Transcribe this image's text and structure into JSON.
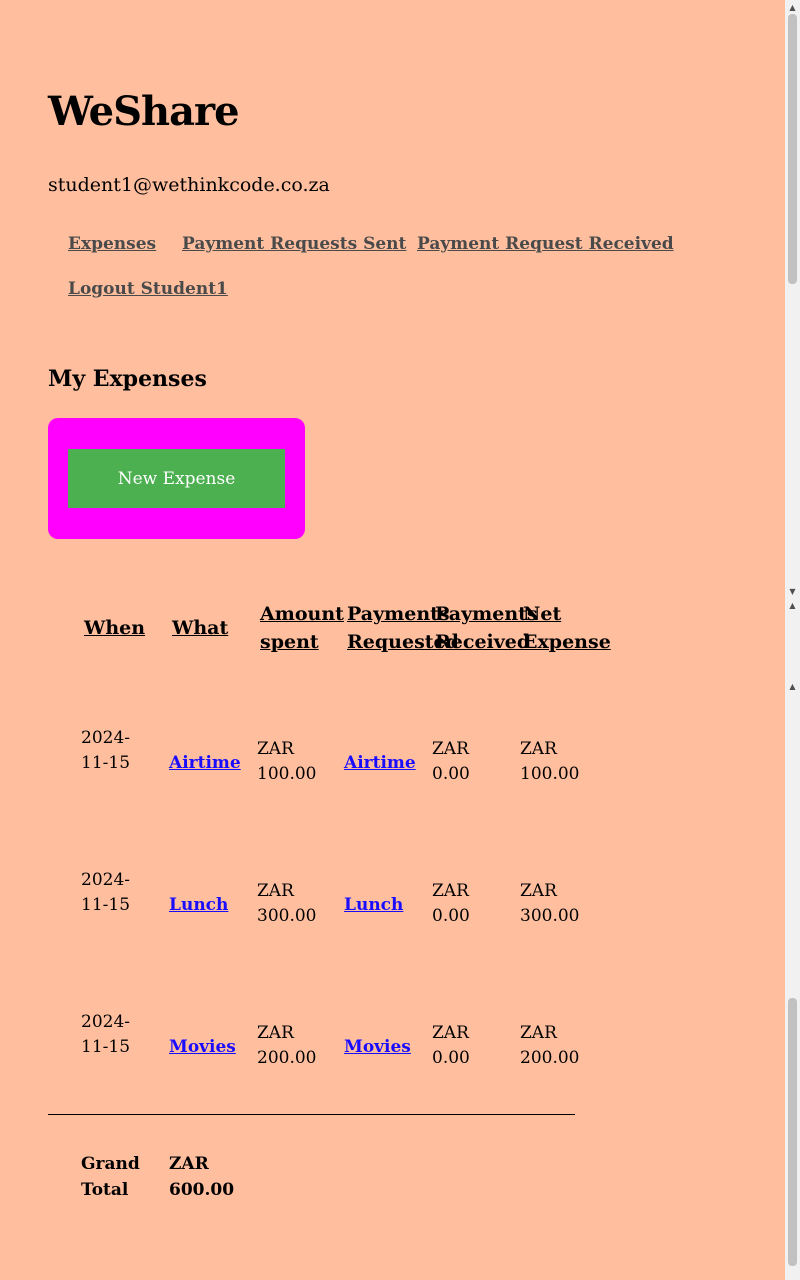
{
  "header": {
    "app_title": "WeShare",
    "user_email": "student1@wethinkcode.co.za"
  },
  "nav": {
    "expenses": "Expenses",
    "requests_sent": "Payment Requests Sent",
    "requests_received": "Payment Request Received",
    "logout": "Logout Student1"
  },
  "main": {
    "section_title": "My Expenses",
    "new_expense_label": "New Expense"
  },
  "table": {
    "headers": {
      "when": "When",
      "what": "What",
      "amount": "Amount spent",
      "requested": "Payments Requested",
      "received": "Payments Received",
      "net": "Net Expense"
    },
    "rows": [
      {
        "when": "2024-11-15",
        "what": "Airtime",
        "amount": "ZAR 100.00",
        "requested": "Airtime",
        "received": "ZAR 0.00",
        "net": "ZAR 100.00"
      },
      {
        "when": "2024-11-15",
        "what": "Lunch",
        "amount": "ZAR 300.00",
        "requested": "Lunch",
        "received": "ZAR 0.00",
        "net": "ZAR 300.00"
      },
      {
        "when": "2024-11-15",
        "what": "Movies",
        "amount": "ZAR 200.00",
        "requested": "Movies",
        "received": "ZAR 0.00",
        "net": "ZAR 200.00"
      }
    ],
    "grand_total_label": "Grand Total",
    "grand_total_value": "ZAR 600.00"
  },
  "colors": {
    "background": "#ffbf9f",
    "action_box": "#ff00ff",
    "button": "#4caf50",
    "link": "#1a0dff"
  }
}
